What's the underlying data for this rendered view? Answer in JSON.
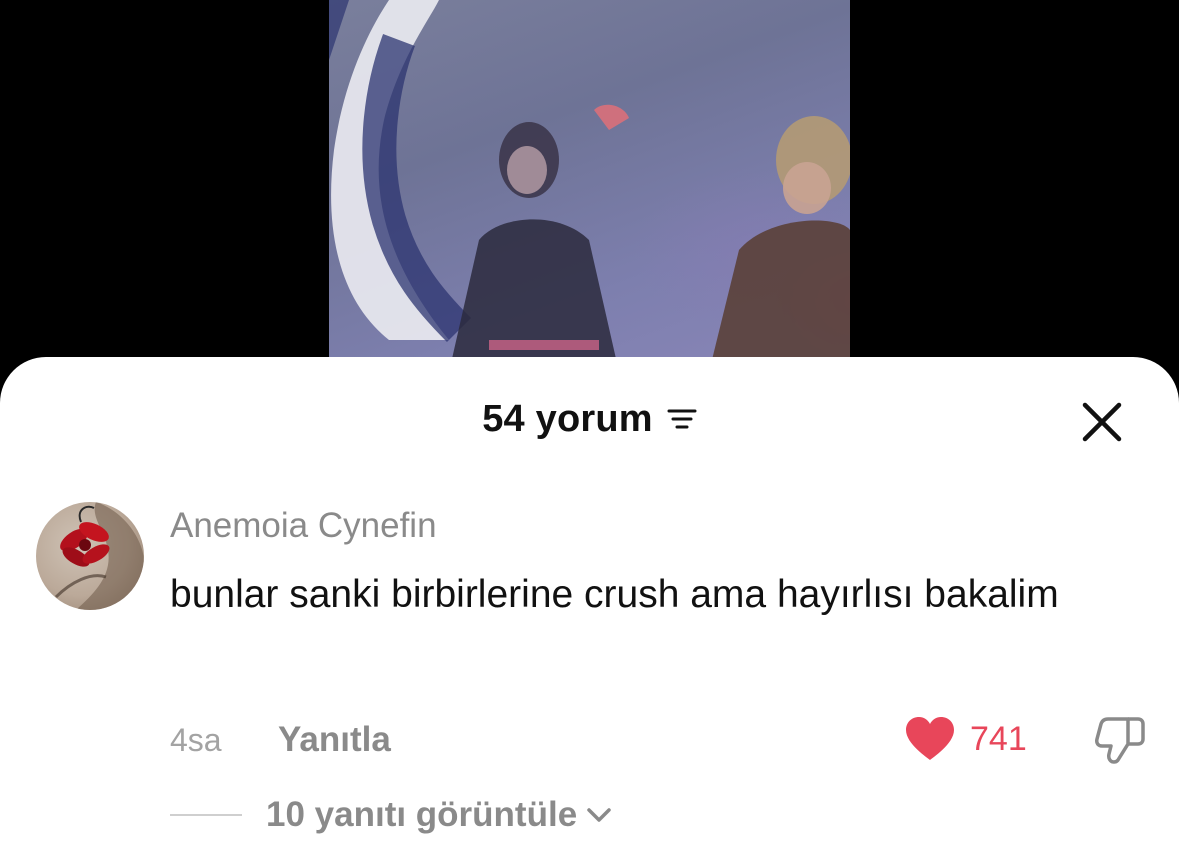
{
  "sheet": {
    "title": "54 yorum"
  },
  "comment": {
    "username": "Anemoia Cynefin",
    "text": "bunlar sanki birbirlerine crush ama hayırlısı bakalim",
    "time": "4sa",
    "reply_label": "Yanıtla",
    "like_count": "741",
    "view_replies_label": "10 yanıtı görüntüle"
  },
  "colors": {
    "like_heart": "#e8465a",
    "muted_text": "#8a8a8a",
    "sheet_bg": "#ffffff",
    "page_bg": "#000000"
  },
  "icons": {
    "sort": "sort-lines-icon",
    "close": "close-icon",
    "like": "heart-icon",
    "dislike": "thumbs-down-icon",
    "expand": "chevron-down-icon"
  }
}
